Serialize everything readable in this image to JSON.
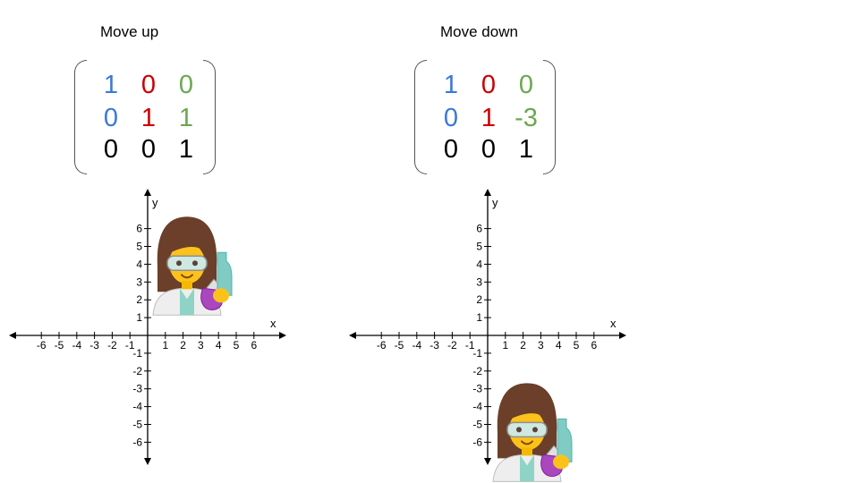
{
  "colors": {
    "col1": "#3b78d8",
    "col2": "#cc0000",
    "col3": "#6aa84f",
    "row3": "#000000"
  },
  "panels": [
    {
      "id": "move-up",
      "title": "Move up",
      "matrix": [
        [
          "1",
          "0",
          "0"
        ],
        [
          "0",
          "1",
          "1"
        ],
        [
          "0",
          "0",
          "1"
        ]
      ],
      "character_y_offset": 3,
      "character_icon": "scientist-woman-emoji",
      "axes": {
        "x_label": "x",
        "y_label": "y",
        "x_ticks": [
          -6,
          -5,
          -4,
          -3,
          -2,
          -1,
          1,
          2,
          3,
          4,
          5,
          6
        ],
        "y_ticks": [
          6,
          5,
          4,
          3,
          2,
          1,
          -1,
          -2,
          -3,
          -4,
          -5,
          -6
        ]
      }
    },
    {
      "id": "move-down",
      "title": "Move down",
      "matrix": [
        [
          "1",
          "0",
          "0"
        ],
        [
          "0",
          "1",
          "-3"
        ],
        [
          "0",
          "0",
          "1"
        ]
      ],
      "character_y_offset": -6,
      "character_icon": "scientist-woman-emoji",
      "axes": {
        "x_label": "x",
        "y_label": "y",
        "x_ticks": [
          -6,
          -5,
          -4,
          -3,
          -2,
          -1,
          1,
          2,
          3,
          4,
          5,
          6
        ],
        "y_ticks": [
          6,
          5,
          4,
          3,
          2,
          1,
          -1,
          -2,
          -3,
          -4,
          -5,
          -6
        ]
      }
    }
  ]
}
